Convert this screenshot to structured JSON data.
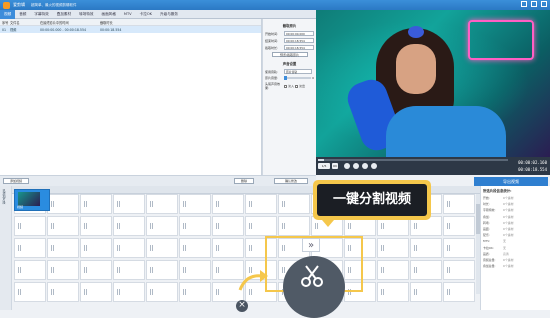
{
  "window": {
    "app_name": "爱剪辑",
    "subtitle": "超简单、最火的视频剪辑软件"
  },
  "tabs": [
    {
      "label": "视频",
      "active": true
    },
    {
      "label": "音频"
    },
    {
      "label": "字幕特效"
    },
    {
      "label": "叠加素材"
    },
    {
      "label": "转场特效"
    },
    {
      "label": "画面风格"
    },
    {
      "label": "MTV"
    },
    {
      "label": "卡拉OK"
    },
    {
      "label": "升级与服务"
    }
  ],
  "table": {
    "headers": [
      "序号",
      "文件名",
      "在最终影片中的时间",
      "截取时长"
    ],
    "rows": [
      [
        "01",
        "视频",
        "00:00:00.000 - 00:00:18.554",
        "00:00:18.554"
      ]
    ]
  },
  "clip_panel": {
    "title": "截取原片",
    "start_label": "开始时间:",
    "start_value": "00:00:00.000",
    "end_label": "结束时间:",
    "end_value": "00:00:18.554",
    "duration_label": "截取时长:",
    "duration_value": "00:00:18.554",
    "preview_button": "预览/截取原片"
  },
  "sound_panel": {
    "title": "声音设置",
    "track_label": "使用音轨:",
    "track_value": "原片音轨",
    "volume_label": "原片音量:",
    "volume_value": "0",
    "fade_label": "头尾声音效果:",
    "fade_in": "淡入",
    "fade_out": "淡出"
  },
  "bottom_buttons": {
    "add_video": "添加视频",
    "delete": "删除",
    "confirm": "确认修改"
  },
  "transport": {
    "current_time": "00:00:02.160",
    "total_time": "00:00:18.554",
    "zoom_label": "1/5"
  },
  "timeline": {
    "side_label": "已添加片段",
    "clip_name": "视频",
    "export_button": "导出视频"
  },
  "info_panel": {
    "title": "所选片段信息统计:",
    "rows": [
      {
        "k": "开始:",
        "v": "0个素材"
      },
      {
        "k": "时长:",
        "v": "0个素材"
      },
      {
        "k": "字幕特效:",
        "v": "0个素材"
      },
      {
        "k": "叠加:",
        "v": "0个素材"
      },
      {
        "k": "转场:",
        "v": "0个素材"
      },
      {
        "k": "画面:",
        "v": "0个素材"
      },
      {
        "k": "配乐:",
        "v": "0个素材"
      },
      {
        "k": "MTV:",
        "v": "无"
      },
      {
        "k": "卡拉OK:",
        "v": "无"
      },
      {
        "k": "画质:",
        "v": "高清"
      },
      {
        "k": "音频总量:",
        "v": "0个素材"
      },
      {
        "k": "叠加总量:",
        "v": "0个素材"
      }
    ]
  },
  "callout": {
    "text": "一键分割视频"
  },
  "colors": {
    "accent": "#2f7fd0",
    "highlight": "#f5c74b",
    "callout_bg": "#1b1e24"
  }
}
